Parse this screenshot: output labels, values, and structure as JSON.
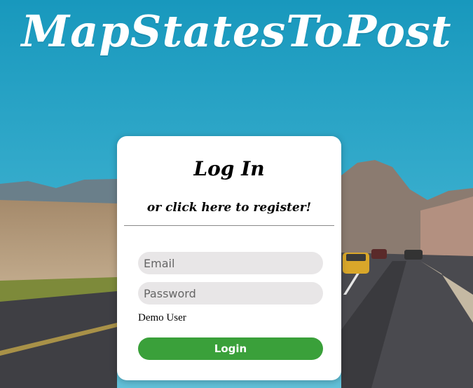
{
  "app": {
    "title": "MapStatesToPost"
  },
  "login_card": {
    "heading": "Log In",
    "register_link": "or click here to register!",
    "email_placeholder": "Email",
    "password_placeholder": "Password",
    "demo_user_label": "Demo User",
    "login_button_label": "Login"
  },
  "colors": {
    "sky": "#1a9fc2",
    "login_button": "#3aa03a",
    "input_bg": "#e8e6e7"
  }
}
